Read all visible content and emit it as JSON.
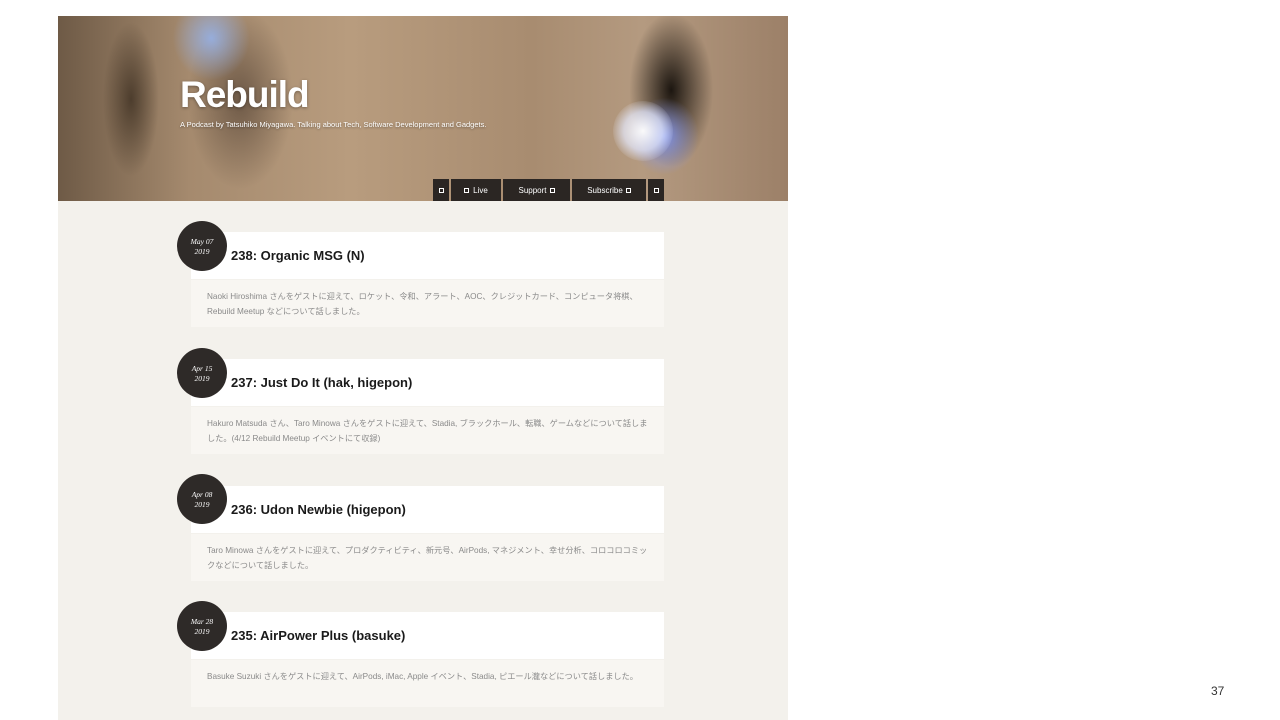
{
  "site": {
    "title": "Rebuild",
    "tagline": "A Podcast by Tatsuhiko Miyagawa. Talking about Tech, Software Development and Gadgets."
  },
  "nav": {
    "items": [
      {
        "label": "",
        "icon": "square-icon"
      },
      {
        "label": "Live",
        "icon": "square-icon"
      },
      {
        "label": "Support",
        "icon": "square-icon"
      },
      {
        "label": "Subscribe",
        "icon": "square-icon"
      },
      {
        "label": "",
        "icon": "square-icon"
      }
    ]
  },
  "episodes": [
    {
      "date_month_day": "May 07",
      "date_year": "2019",
      "title": "238: Organic MSG (N)",
      "description": "Naoki Hiroshima さんをゲストに迎えて、ロケット、令和、アラート、AOC、クレジットカード、コンピュータ将棋、Rebuild Meetup などについて話しました。"
    },
    {
      "date_month_day": "Apr 15",
      "date_year": "2019",
      "title": "237: Just Do It (hak, higepon)",
      "description": "Hakuro Matsuda さん、Taro Minowa さんをゲストに迎えて、Stadia, ブラックホール、転職、ゲームなどについて話しました。(4/12 Rebuild Meetup イベントにて収録)"
    },
    {
      "date_month_day": "Apr 08",
      "date_year": "2019",
      "title": "236: Udon Newbie (higepon)",
      "description": "Taro Minowa さんをゲストに迎えて、プロダクティビティ、新元号、AirPods, マネジメント、幸せ分析、コロコロコミックなどについて話しました。"
    },
    {
      "date_month_day": "Mar 28",
      "date_year": "2019",
      "title": "235: AirPower Plus (basuke)",
      "description": "Basuke Suzuki さんをゲストに迎えて、AirPods, iMac, Apple イベント、Stadia, ピエール瀧などについて話しました。"
    }
  ],
  "slide": {
    "page_number": "37"
  }
}
